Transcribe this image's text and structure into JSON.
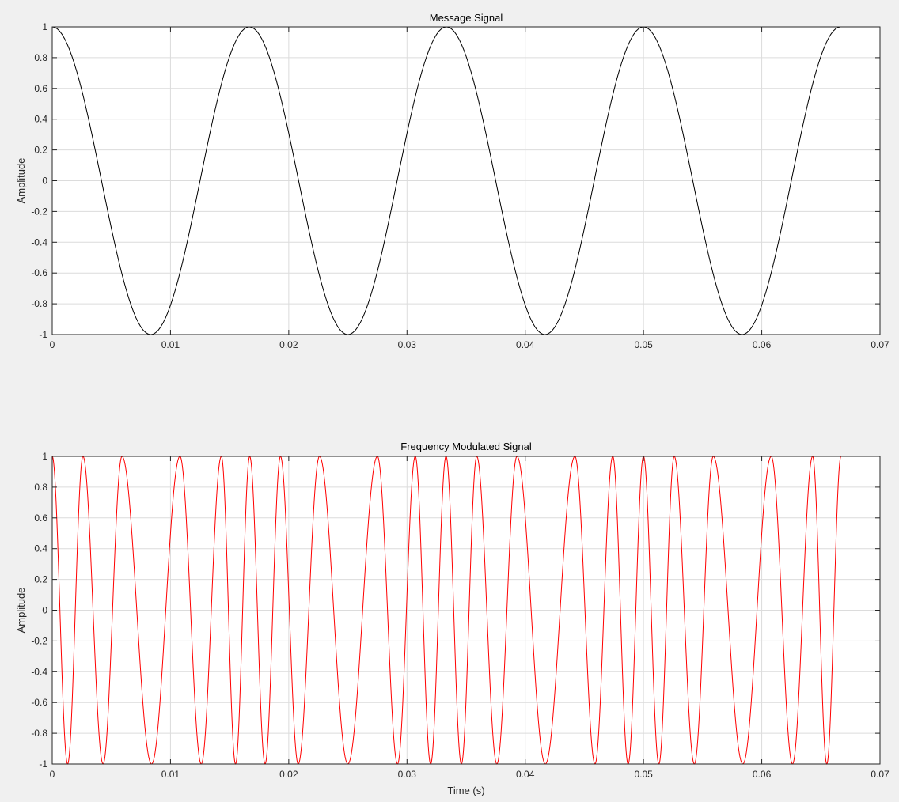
{
  "chart_data": [
    {
      "type": "line",
      "title": "Message Signal",
      "xlabel": "",
      "ylabel": "Amplitude",
      "xlim": [
        0,
        0.07
      ],
      "ylim": [
        -1,
        1
      ],
      "xticks": [
        "0",
        "0.01",
        "0.02",
        "0.03",
        "0.04",
        "0.05",
        "0.06",
        "0.07"
      ],
      "yticks": [
        "1",
        "0.8",
        "0.6",
        "0.4",
        "0.2",
        "0",
        "-0.2",
        "-0.4",
        "-0.6",
        "-0.8",
        "-1"
      ],
      "grid": true,
      "series": [
        {
          "color": "#000000",
          "x": [
            0,
            0.008333,
            0.016667,
            0.025,
            0.033333,
            0.041667,
            0.05,
            0.058333,
            0.066667
          ],
          "y": [
            1,
            -1,
            1,
            -1,
            1,
            -1,
            1,
            -1,
            1
          ]
        }
      ]
    },
    {
      "type": "line",
      "title": "Frequency Modulated Signal",
      "xlabel": "Time (s)",
      "ylabel": "Amplitude",
      "xlim": [
        0,
        0.07
      ],
      "ylim": [
        -1,
        1
      ],
      "xticks": [
        "0",
        "0.01",
        "0.02",
        "0.03",
        "0.04",
        "0.05",
        "0.06",
        "0.07"
      ],
      "yticks": [
        "1",
        "0.8",
        "0.6",
        "0.4",
        "0.2",
        "0",
        "-0.2",
        "-0.4",
        "-0.6",
        "-0.8",
        "-1"
      ],
      "grid": true,
      "series": [
        {
          "color": "#ff0000",
          "x": [
            0,
            0.0013,
            0.0026,
            0.0043,
            0.0059,
            0.0084,
            0.0108,
            0.0126,
            0.0143,
            0.0155,
            0.0167,
            0.018,
            0.0193,
            0.0208,
            0.0226,
            0.025,
            0.0275,
            0.0292,
            0.0307,
            0.032,
            0.0333,
            0.0346,
            0.0359,
            0.0376,
            0.0393,
            0.0417,
            0.0442,
            0.0459,
            0.0474,
            0.0487,
            0.05,
            0.0513,
            0.0526,
            0.0543,
            0.0559,
            0.0584,
            0.0608,
            0.0626,
            0.0643,
            0.0655,
            0.0667
          ],
          "y": [
            1,
            -1,
            1,
            -1,
            1,
            -1,
            1,
            -1,
            1,
            -1,
            1,
            -1,
            1,
            -1,
            1,
            -1,
            1,
            -1,
            1,
            -1,
            1,
            -1,
            1,
            -1,
            1,
            -1,
            1,
            -1,
            1,
            -1,
            1,
            -1,
            1,
            -1,
            1,
            -1,
            1,
            -1,
            1,
            -1,
            1
          ]
        }
      ]
    }
  ]
}
